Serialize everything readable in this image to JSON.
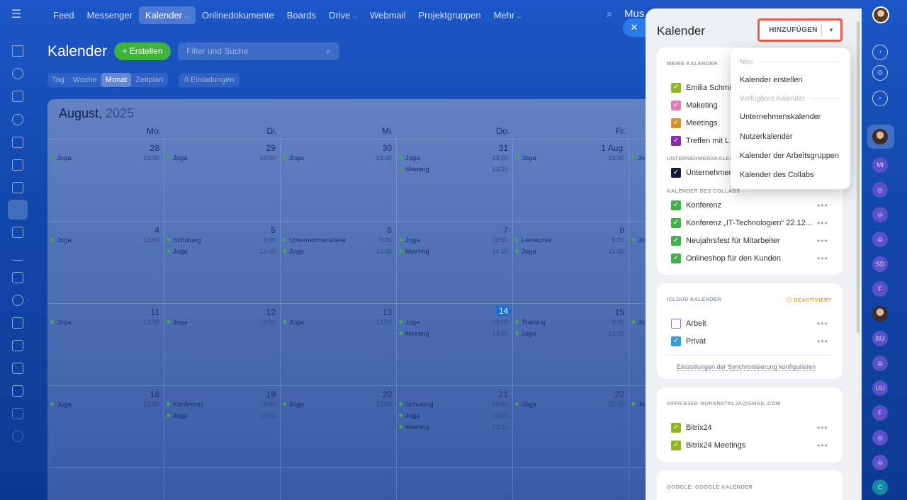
{
  "topnav": {
    "items": [
      "Feed",
      "Messenger",
      "Kalender",
      "Onlinedokumente",
      "Boards",
      "Drive",
      "Webmail",
      "Projektgruppen",
      "Mehr"
    ],
    "search_text": "Mus"
  },
  "calendar": {
    "title": "Kalender",
    "create_label": "+ Erstellen",
    "filter_placeholder": "Filter und Suche",
    "views": [
      "Tag",
      "Woche",
      "Monat",
      "Zeitplan"
    ],
    "invites_label": "0  Einladungen",
    "month": "August,",
    "year": "2025",
    "weekdays": [
      "Mo.",
      "Di.",
      "Mi.",
      "Do.",
      "Fr."
    ],
    "week1": {
      "days": [
        "28",
        "29",
        "30",
        "31",
        "1 Aug"
      ]
    },
    "week2": {
      "days": [
        "4",
        "5",
        "6",
        "7",
        "8"
      ]
    },
    "week3": {
      "days": [
        "11",
        "12",
        "13",
        "14",
        "15"
      ]
    },
    "week4": {
      "days": [
        "18",
        "19",
        "20",
        "21",
        "22"
      ]
    },
    "events": {
      "joga": "Joga",
      "meeting": "Meeting",
      "schulung": "Schulung",
      "unternehmensfeier": "Unternehmensfeier",
      "lernkurse": "Lernkurse",
      "training": "Training",
      "konferenz": "Konferenz",
      "jo": "Jo",
      "t1300": "13:00",
      "t1420": "14:20",
      "t900": "9:00",
      "t1000": "10:00",
      "t1500": "15:00",
      "t1310": "13:10"
    }
  },
  "panel": {
    "title": "Kalender",
    "add_button": "HINZUFÜGEN",
    "meine_section": "MEINE KALENDER",
    "meine": [
      "Emilia Schmi",
      "Maketing",
      "Meetings",
      "Treffen mit L"
    ],
    "unternehmens_section": "UNTERNEHMENSKALEN",
    "unternehmens": [
      "Unternehmen"
    ],
    "collabs_section": "KALENDER DES COLLABS",
    "collabs": [
      "Konferenz",
      "Konferenz „IT-Technologien“ 22.12...",
      "Neujahrsfest für Mitarbeiter",
      "Onlineshop für den Kunden"
    ],
    "icloud_section": "ICLOUD KALENDER",
    "icloud_status": "ⓘ DEAKTIVIERT",
    "icloud": [
      "Arbeit",
      "Privat"
    ],
    "sync_link": "Einstellungen der Synchronisierung konfigurieren",
    "office_section": "OFFICE365: RUKSNATALJA@GMAIL.COM",
    "office": [
      "Bitrix24",
      "Bitrix24 Meetings"
    ],
    "google_section": "GOOGLE: GOOGLE KALENDER",
    "dots": "•••"
  },
  "dropdown": {
    "neu_header": "Neu",
    "create": "Kalender erstellen",
    "available_header": "Verfügbare Kalender",
    "items": [
      "Unternehmenskalender",
      "Nutzerkalender",
      "Kalender der Arbeitsgruppen",
      "Kalender des Collabs"
    ]
  },
  "right_sidebar": {
    "initials": [
      "MI",
      "SD",
      "F",
      "BU",
      "UU",
      "F",
      "C"
    ]
  },
  "colors": {
    "green": "#40b04a",
    "pink": "#e07bb5",
    "orange": "#d3922a",
    "purple": "#8a2aa8",
    "navy": "#0f1a3e",
    "blue": "#3a9ad9",
    "olive": "#92b526"
  }
}
